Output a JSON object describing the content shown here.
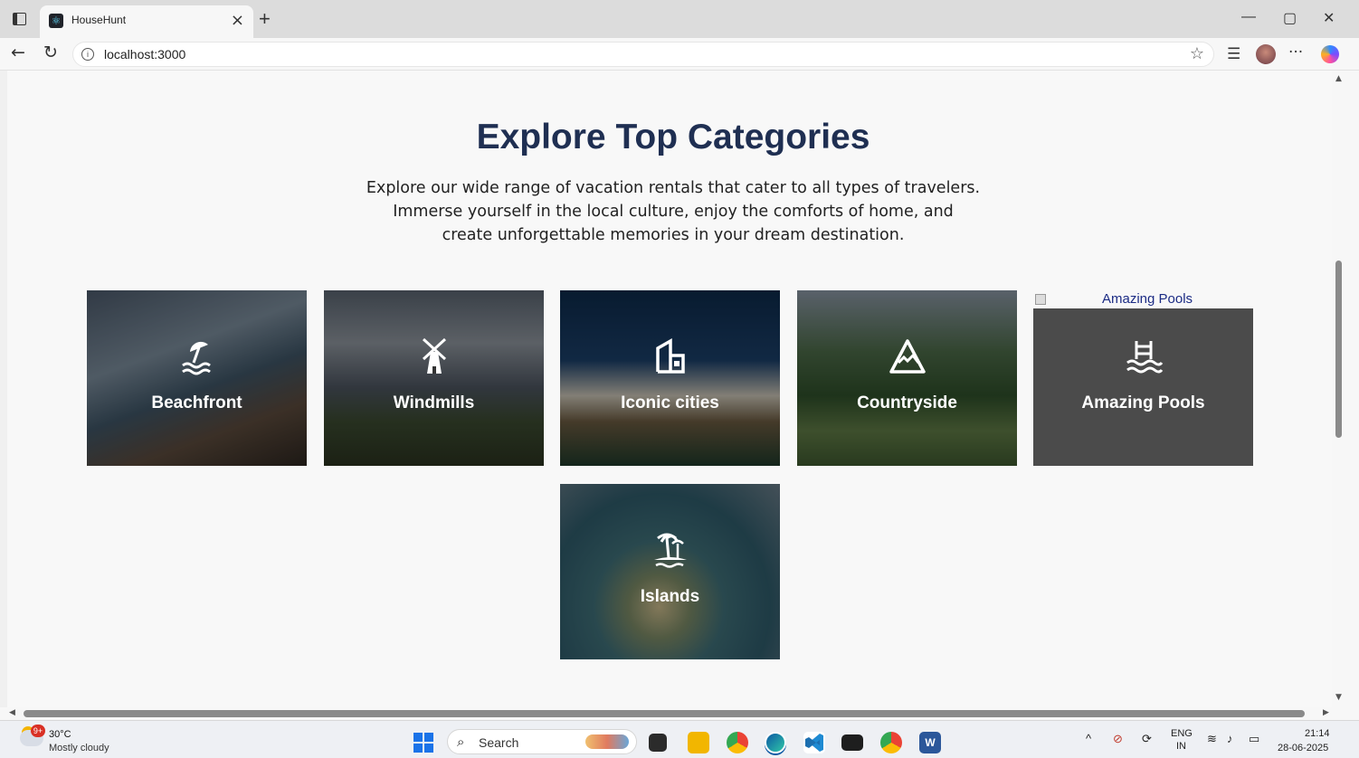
{
  "browser": {
    "tab_title": "HouseHunt",
    "tab_close": "×",
    "new_tab": "+",
    "url": "localhost:3000",
    "window_minimize": "—",
    "window_maximize": "▢",
    "window_close": "✕",
    "more_menu": "···"
  },
  "page": {
    "title": "Explore Top Categories",
    "subtitle": "Explore our wide range of vacation rentals that cater to all types of travelers. Immerse yourself in the local culture, enjoy the comforts of home, and create unforgettable memories in your dream destination."
  },
  "categories": [
    {
      "label": "Beachfront",
      "icon": "beach-umbrella-icon"
    },
    {
      "label": "Windmills",
      "icon": "windmill-icon"
    },
    {
      "label": "Iconic cities",
      "icon": "city-icon"
    },
    {
      "label": "Countryside",
      "icon": "mountain-icon"
    },
    {
      "label": "Amazing Pools",
      "icon": "pool-icon",
      "image_alt": "Amazing Pools"
    },
    {
      "label": "Islands",
      "icon": "palm-island-icon"
    }
  ],
  "taskbar": {
    "weather_badge": "9+",
    "temperature": "30°C",
    "weather_desc": "Mostly cloudy",
    "search_label": "Search",
    "language_top": "ENG",
    "language_bottom": "IN",
    "time": "21:14",
    "date": "28-06-2025"
  },
  "colors": {
    "heading": "#1f2f52",
    "page_bg": "#f8f8f8",
    "card_overlay": "rgba(0,0,0,0.35)"
  }
}
